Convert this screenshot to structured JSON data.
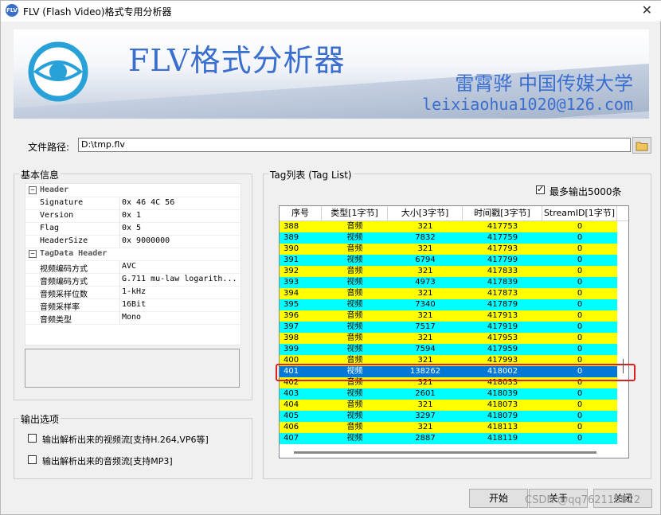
{
  "window": {
    "title": "FLV (Flash Video)格式专用分析器",
    "app_icon_text": "FLV"
  },
  "banner": {
    "title": "FLV格式分析器",
    "author": "雷霄骅 中国传媒大学",
    "email": "leixiaohua1020@126.com"
  },
  "file": {
    "label": "文件路径:",
    "value": "D:\\tmp.flv"
  },
  "basic_info": {
    "title": "基本信息",
    "categories": [
      {
        "name": "Header",
        "props": [
          {
            "name": "Signature",
            "value": "0x 46 4C 56"
          },
          {
            "name": "Version",
            "value": "0x 1"
          },
          {
            "name": "Flag",
            "value": "0x 5"
          },
          {
            "name": "HeaderSize",
            "value": "0x 9000000"
          }
        ]
      },
      {
        "name": "TagData Header",
        "props": [
          {
            "name": "视频编码方式",
            "value": "AVC"
          },
          {
            "name": "音频编码方式",
            "value": "G.711 mu-law logarith..."
          },
          {
            "name": "音频采样位数",
            "value": "1-kHz"
          },
          {
            "name": "音频采样率",
            "value": "16Bit"
          },
          {
            "name": "音频类型",
            "value": "Mono"
          }
        ]
      }
    ]
  },
  "output_options": {
    "title": "输出选项",
    "video_label": "输出解析出来的视频流[支持H.264,VP6等]",
    "audio_label": "输出解析出来的音频流[支持MP3]"
  },
  "tag_list": {
    "title": "Tag列表 (Tag List)",
    "max_output_label": "最多输出5000条",
    "columns": [
      "序号",
      "类型[1字节]",
      "大小[3字节]",
      "时间戳[3字节]",
      "StreamID[1字节]"
    ],
    "rows": [
      [
        "388",
        "音频",
        "321",
        "417753",
        "0"
      ],
      [
        "389",
        "视频",
        "7832",
        "417759",
        "0"
      ],
      [
        "390",
        "音频",
        "321",
        "417793",
        "0"
      ],
      [
        "391",
        "视频",
        "6794",
        "417799",
        "0"
      ],
      [
        "392",
        "音频",
        "321",
        "417833",
        "0"
      ],
      [
        "393",
        "视频",
        "4973",
        "417839",
        "0"
      ],
      [
        "394",
        "音频",
        "321",
        "417873",
        "0"
      ],
      [
        "395",
        "视频",
        "7340",
        "417879",
        "0"
      ],
      [
        "396",
        "音频",
        "321",
        "417913",
        "0"
      ],
      [
        "397",
        "视频",
        "7517",
        "417919",
        "0"
      ],
      [
        "398",
        "音频",
        "321",
        "417953",
        "0"
      ],
      [
        "399",
        "视频",
        "7594",
        "417959",
        "0"
      ],
      [
        "400",
        "音频",
        "321",
        "417993",
        "0"
      ],
      [
        "401",
        "视频",
        "138262",
        "418002",
        "0"
      ],
      [
        "402",
        "音频",
        "321",
        "418033",
        "0"
      ],
      [
        "403",
        "视频",
        "2601",
        "418039",
        "0"
      ],
      [
        "404",
        "音频",
        "321",
        "418073",
        "0"
      ],
      [
        "405",
        "视频",
        "3297",
        "418079",
        "0"
      ],
      [
        "406",
        "音频",
        "321",
        "418113",
        "0"
      ],
      [
        "407",
        "视频",
        "2887",
        "418119",
        "0"
      ]
    ],
    "selected_index": 13
  },
  "buttons": {
    "start": "开始",
    "about": "关于",
    "close": "关闭"
  },
  "watermark": "CSDN @qq762118822",
  "colors": {
    "audio_row": "#ffff00",
    "video_row": "#00ffff",
    "selected_row": "#0078d7",
    "accent": "#3a6fd0"
  }
}
